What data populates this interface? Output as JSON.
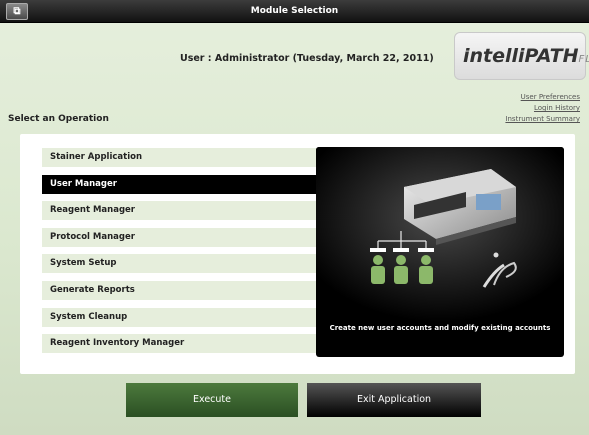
{
  "window": {
    "title": "Module Selection",
    "user_line": "User : Administrator  (Tuesday, March 22, 2011)"
  },
  "logo": {
    "brand": "intelliPATH",
    "suffix": "FLX"
  },
  "links": [
    {
      "label": "User Preferences"
    },
    {
      "label": "Login History"
    },
    {
      "label": "Instrument Summary"
    }
  ],
  "section_label": "Select an Operation",
  "operations": [
    {
      "label": "Stainer Application",
      "selected": false
    },
    {
      "label": "User Manager",
      "selected": true
    },
    {
      "label": "Reagent Manager",
      "selected": false
    },
    {
      "label": "Protocol Manager",
      "selected": false
    },
    {
      "label": "System Setup",
      "selected": false
    },
    {
      "label": "Generate Reports",
      "selected": false
    },
    {
      "label": "System Cleanup",
      "selected": false
    },
    {
      "label": "Reagent Inventory Manager",
      "selected": false
    }
  ],
  "preview": {
    "caption": "Create new user accounts and modify existing accounts",
    "icon": "users-hierarchy-with-instrument"
  },
  "buttons": {
    "execute": "Execute",
    "exit": "Exit Application"
  },
  "colors": {
    "selected_bg": "#000000",
    "execute_bg": "#3b6531",
    "item_bg": "#e6eedc"
  }
}
